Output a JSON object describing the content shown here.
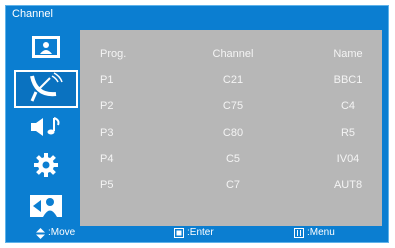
{
  "title": "Channel",
  "sidebar": {
    "items": [
      {
        "icon": "picture-icon",
        "active": false
      },
      {
        "icon": "satellite-dish-icon",
        "active": true
      },
      {
        "icon": "speaker-music-icon",
        "active": false
      },
      {
        "icon": "gear-icon",
        "active": false
      },
      {
        "icon": "person-icon",
        "active": false
      }
    ]
  },
  "table": {
    "headers": {
      "prog": "Prog.",
      "channel": "Channel",
      "name": "Name"
    },
    "rows": [
      {
        "prog": "P1",
        "channel": "C21",
        "name": "BBC1"
      },
      {
        "prog": "P2",
        "channel": "C75",
        "name": "C4"
      },
      {
        "prog": "P3",
        "channel": "C80",
        "name": "R5"
      },
      {
        "prog": "P4",
        "channel": "C5",
        "name": "IV04"
      },
      {
        "prog": "P5",
        "channel": "C7",
        "name": "AUT8"
      }
    ]
  },
  "footer": {
    "move": ":Move",
    "enter": ":Enter",
    "menu": ":Menu"
  },
  "colors": {
    "background": "#0b7ed1",
    "panel": "#b7b7b7",
    "text": "#ffffff"
  }
}
